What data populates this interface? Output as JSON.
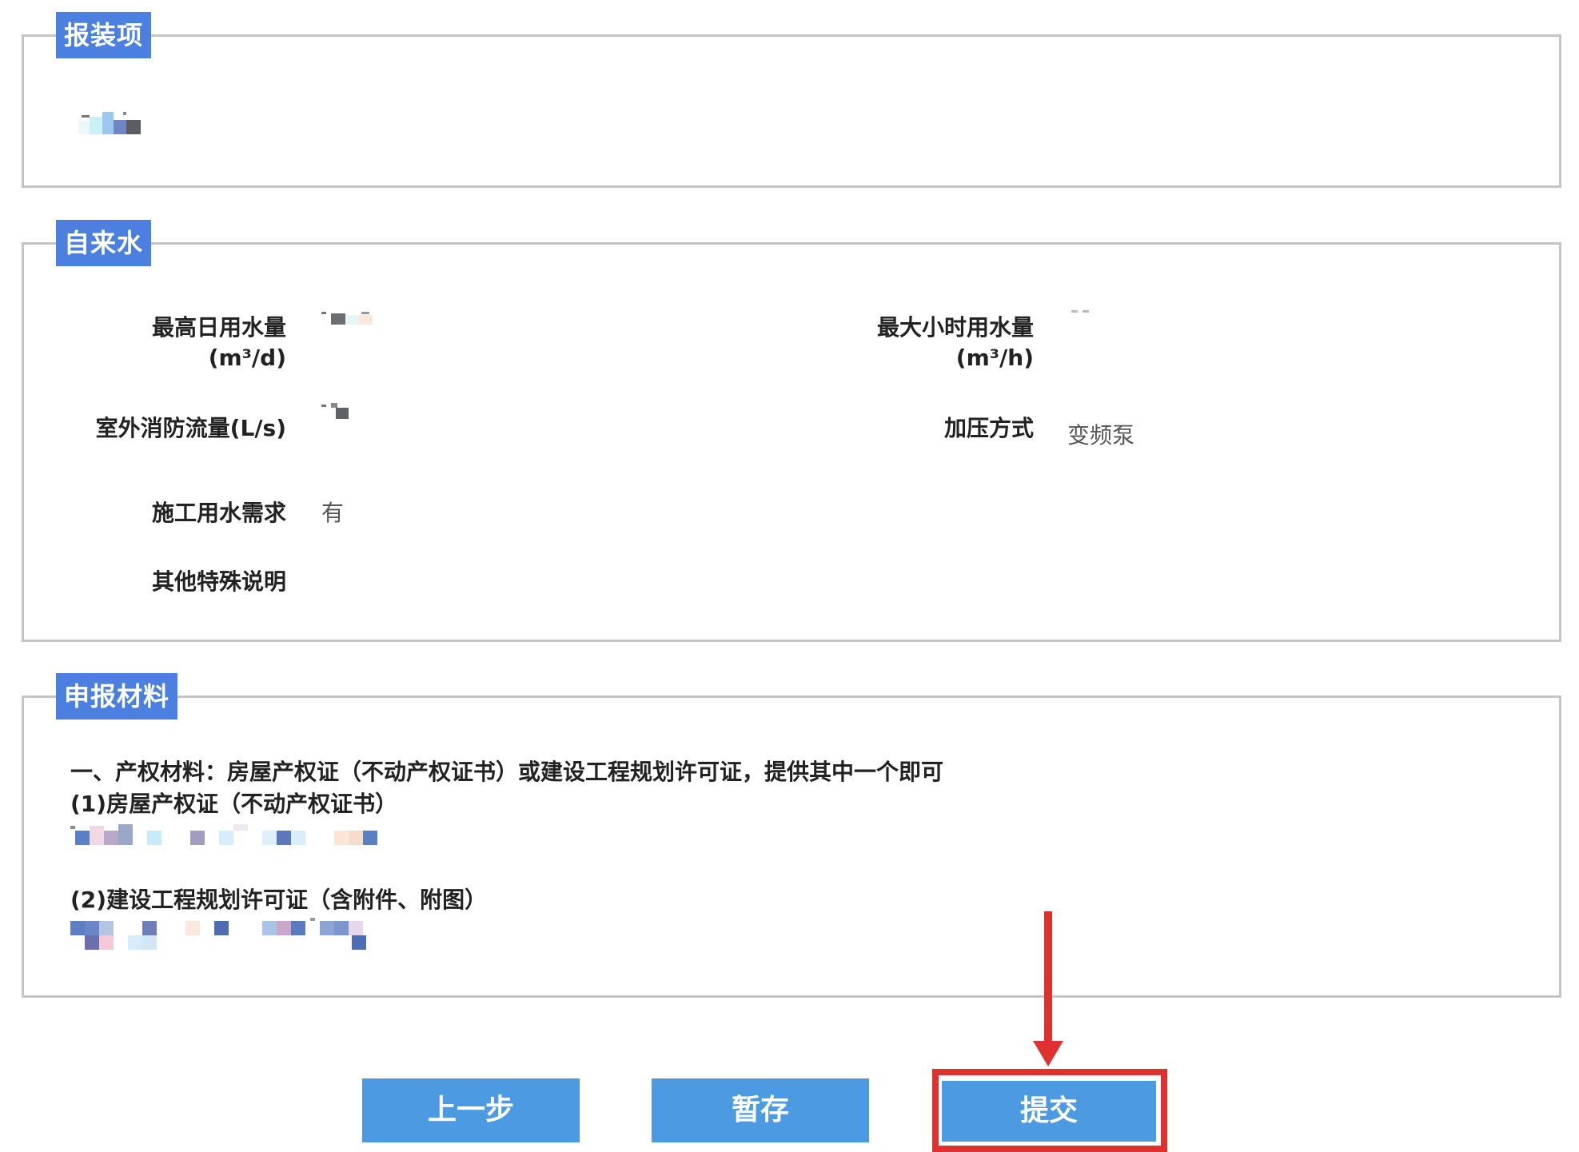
{
  "sections": {
    "baozhuang": {
      "title": "报装项"
    },
    "water": {
      "title": "自来水",
      "fields": {
        "max_daily_label_line1": "最高日用水量",
        "max_daily_label_line2": "(m³/d)",
        "max_hourly_label_line1": "最大小时用水量",
        "max_hourly_label_line2": "(m³/h)",
        "fire_flow_label": "室外消防流量(L/s)",
        "pressurize_label": "加压方式",
        "pressurize_value": "变频泵",
        "construction_label": "施工用水需求",
        "construction_value": "有",
        "other_label": "其他特殊说明"
      }
    },
    "materials": {
      "title": "申报材料",
      "heading": "一、产权材料：房屋产权证（不动产权证书）或建设工程规划许可证，提供其中一个即可",
      "item1": "(1)房屋产权证（不动产权证书）",
      "item2": "(2)建设工程规划许可证（含附件、附图）"
    }
  },
  "buttons": {
    "prev": "上一步",
    "save": "暂存",
    "submit": "提交"
  },
  "colors": {
    "legend_bg": "#4b7fe0",
    "button_bg": "#4c9ae2",
    "highlight": "#e03131",
    "border": "#c4c4c4"
  }
}
